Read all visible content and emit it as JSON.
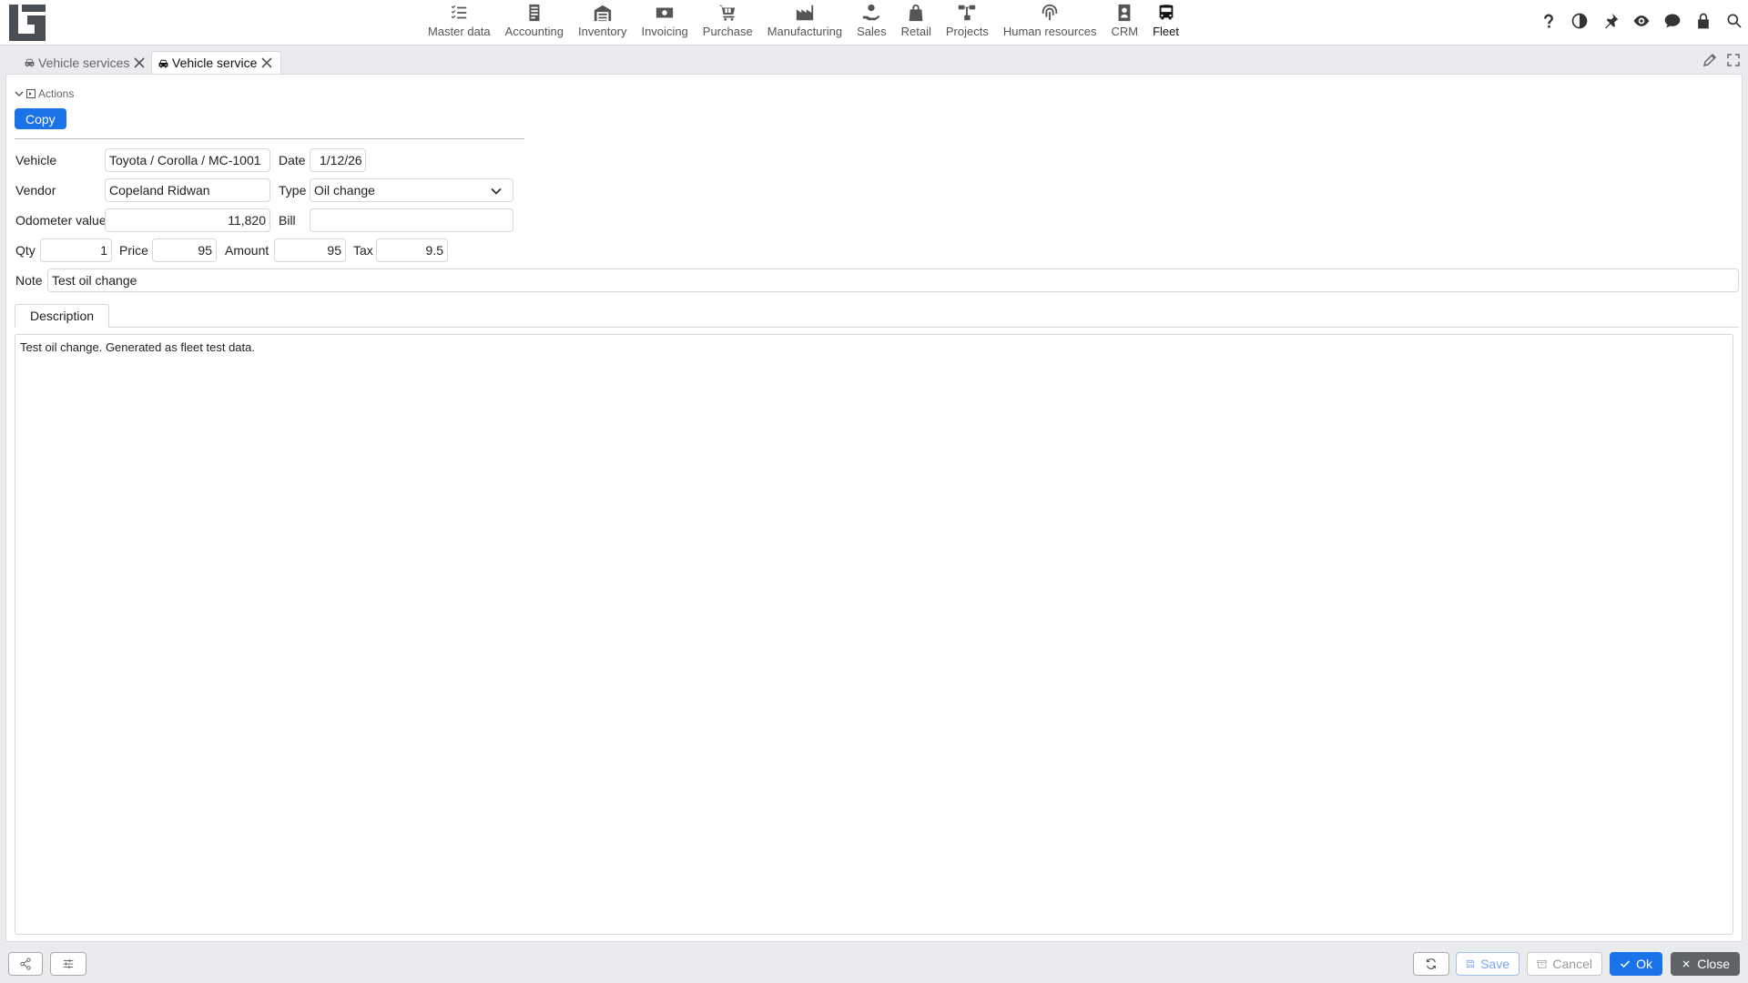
{
  "app": {
    "accent_color": "#1a73e8",
    "modules": [
      {
        "label": "Master data",
        "icon": "checklist-icon"
      },
      {
        "label": "Accounting",
        "icon": "ledger-icon"
      },
      {
        "label": "Inventory",
        "icon": "warehouse-icon"
      },
      {
        "label": "Invoicing",
        "icon": "banknote-icon"
      },
      {
        "label": "Purchase",
        "icon": "cart-icon"
      },
      {
        "label": "Manufacturing",
        "icon": "factory-icon"
      },
      {
        "label": "Sales",
        "icon": "hand-coin-icon"
      },
      {
        "label": "Retail",
        "icon": "shopping-bag-icon"
      },
      {
        "label": "Projects",
        "icon": "hierarchy-icon"
      },
      {
        "label": "Human resources",
        "icon": "fingerprint-icon"
      },
      {
        "label": "CRM",
        "icon": "contact-card-icon"
      },
      {
        "label": "Fleet",
        "icon": "bus-icon",
        "active": true
      }
    ],
    "right_icons": [
      "help-icon",
      "contrast-icon",
      "pin-icon",
      "eye-icon",
      "chat-icon",
      "lock-icon",
      "search-icon"
    ]
  },
  "tabs": [
    {
      "label": "Vehicle services",
      "icon": "car-icon",
      "active": false
    },
    {
      "label": "Vehicle service",
      "icon": "car-icon",
      "active": true
    }
  ],
  "form": {
    "actions_label": "Actions",
    "copy_label": "Copy",
    "vehicle": {
      "label": "Vehicle",
      "value": "Toyota / Corolla / MC-1001"
    },
    "date": {
      "label": "Date",
      "value": "1/12/26"
    },
    "vendor": {
      "label": "Vendor",
      "value": "Copeland Ridwan"
    },
    "type": {
      "label": "Type",
      "value": "Oil change"
    },
    "odometer": {
      "label": "Odometer value",
      "value": "11,820"
    },
    "bill": {
      "label": "Bill",
      "value": ""
    },
    "qty": {
      "label": "Qty",
      "value": "1"
    },
    "price": {
      "label": "Price",
      "value": "95"
    },
    "amount": {
      "label": "Amount",
      "value": "95"
    },
    "tax": {
      "label": "Tax",
      "value": "9.5"
    },
    "note": {
      "label": "Note",
      "value": "Test oil change"
    },
    "description_tab": "Description",
    "description": "Test oil change. Generated as fleet test data."
  },
  "footer": {
    "save_label": "Save",
    "cancel_label": "Cancel",
    "ok_label": "Ok",
    "close_label": "Close"
  }
}
